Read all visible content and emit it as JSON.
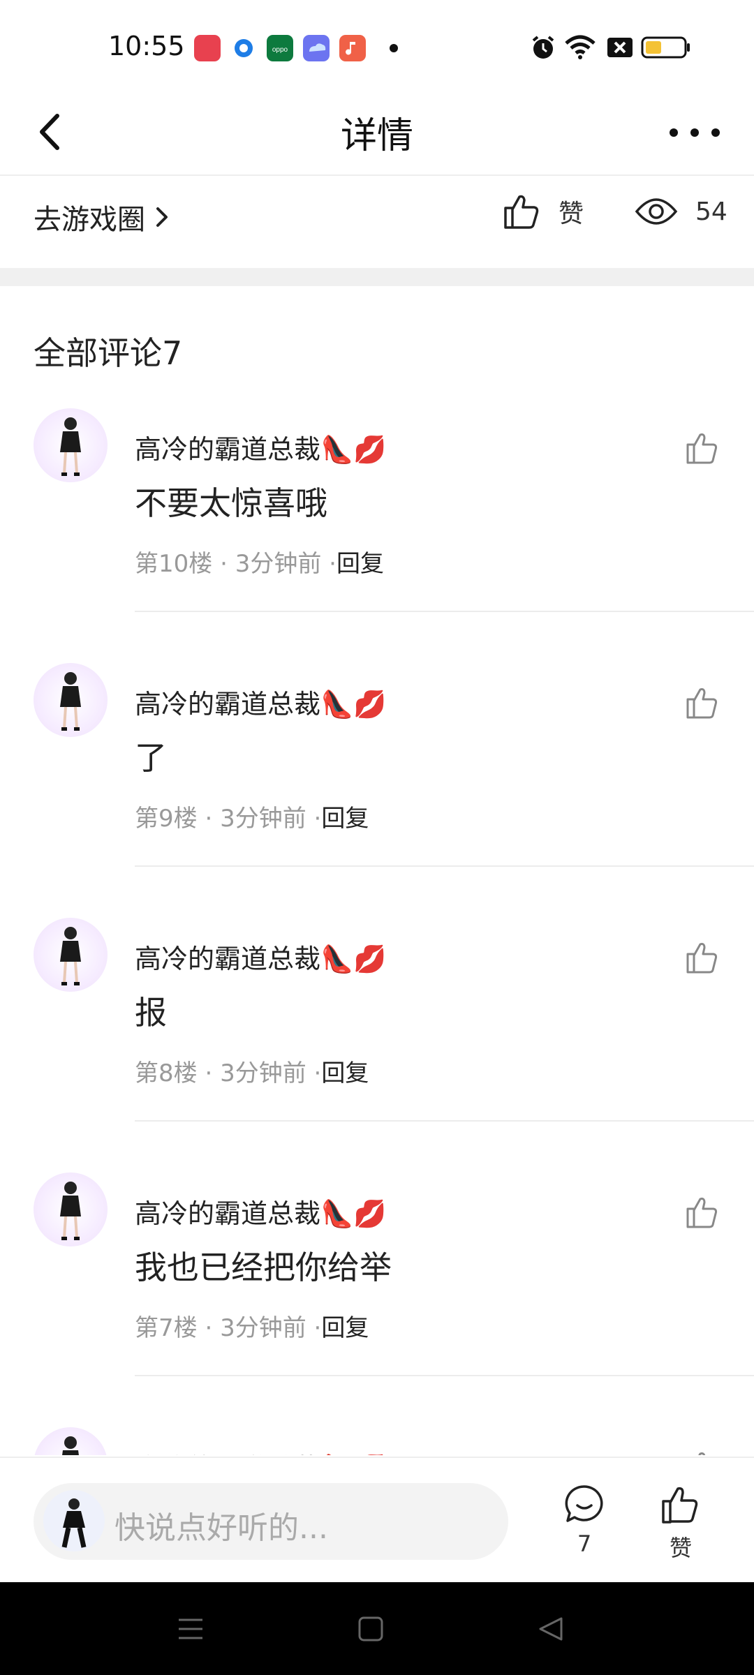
{
  "status_bar": {
    "time": "10:55",
    "app_icons": [
      "video-app-icon",
      "browser-app-icon",
      "oppo-app-icon",
      "cloud-app-icon",
      "music-app-icon"
    ],
    "app_colors": [
      "#e8414f",
      "#1e7de6",
      "#0d7a3e",
      "#6c74f0",
      "#f06147"
    ],
    "right_icons": [
      "alarm-icon",
      "wifi-icon",
      "sim-off-icon",
      "battery-icon"
    ]
  },
  "header": {
    "title": "详情"
  },
  "action_row": {
    "goto_label": "去游戏圈",
    "like_label": "赞",
    "views_count": "54"
  },
  "comments_section": {
    "title": "全部评论7",
    "items": [
      {
        "username": "高冷的霸道总裁👠💋",
        "text": "不要太惊喜哦",
        "floor": "第10楼",
        "time": "3分钟前",
        "reply_label": "回复"
      },
      {
        "username": "高冷的霸道总裁👠💋",
        "text": "了",
        "floor": "第9楼",
        "time": "3分钟前",
        "reply_label": "回复"
      },
      {
        "username": "高冷的霸道总裁👠💋",
        "text": "报",
        "floor": "第8楼",
        "time": "3分钟前",
        "reply_label": "回复"
      },
      {
        "username": "高冷的霸道总裁👠💋",
        "text": "我也已经把你给举",
        "floor": "第7楼",
        "time": "3分钟前",
        "reply_label": "回复"
      },
      {
        "username": "高冷的霸道总裁👠💋",
        "text": "",
        "floor": "",
        "time": "",
        "reply_label": ""
      }
    ]
  },
  "bottom_bar": {
    "input_placeholder": "快说点好听的...",
    "comment_count": "7",
    "like_label": "赞"
  },
  "nav_bar": {
    "icons": [
      "menu-icon",
      "home-icon",
      "back-triangle-icon"
    ]
  }
}
